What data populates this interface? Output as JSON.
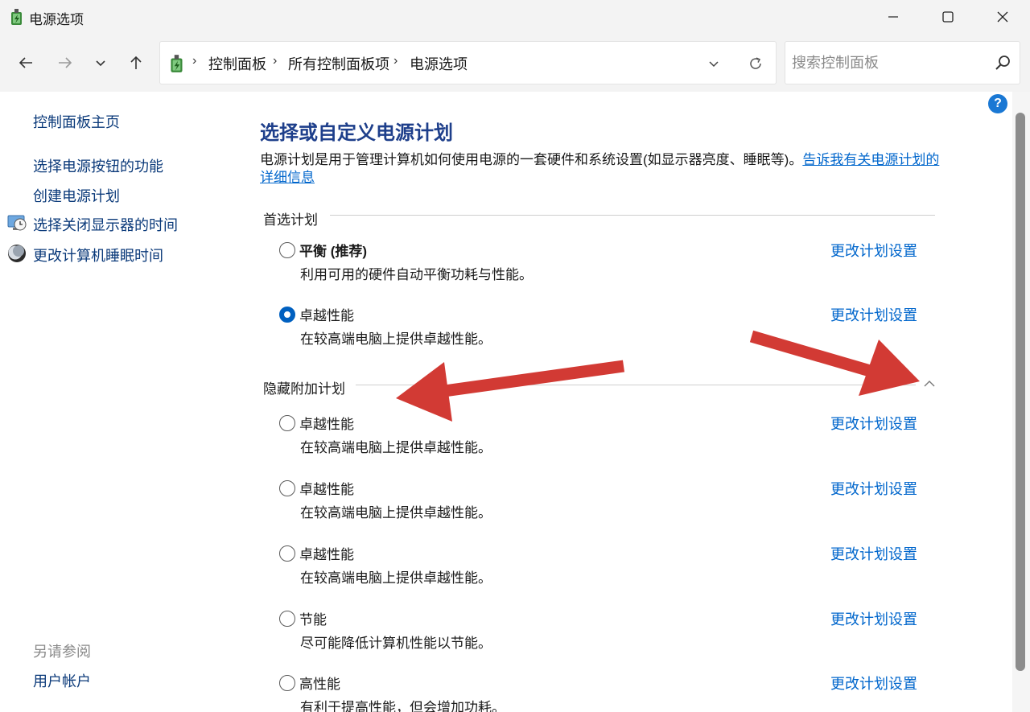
{
  "window": {
    "title": "电源选项"
  },
  "nav": {
    "breadcrumbs": [
      "控制面板",
      "所有控制面板项",
      "电源选项"
    ],
    "separator": "›",
    "search_placeholder": "搜索控制面板"
  },
  "sidebar": {
    "home": "控制面板主页",
    "links": [
      "选择电源按钮的功能",
      "创建电源计划",
      "选择关闭显示器的时间",
      "更改计算机睡眠时间"
    ],
    "see_also_title": "另请参阅",
    "see_also_links": [
      "用户帐户"
    ]
  },
  "main": {
    "title": "选择或自定义电源计划",
    "description": "电源计划是用于管理计算机如何使用电源的一套硬件和系统设置(如显示器亮度、睡眠等)。",
    "description_link": "告诉我有关电源计划的详细信息",
    "preferred_heading": "首选计划",
    "hidden_heading": "隐藏附加计划",
    "change_label": "更改计划设置",
    "help_label": "?",
    "preferred_plans": [
      {
        "name": "平衡 (推荐)",
        "desc": "利用可用的硬件自动平衡功耗与性能。",
        "selected": false
      },
      {
        "name": "卓越性能",
        "desc": "在较高端电脑上提供卓越性能。",
        "selected": true
      }
    ],
    "hidden_plans": [
      {
        "name": "卓越性能",
        "desc": "在较高端电脑上提供卓越性能。",
        "selected": false
      },
      {
        "name": "卓越性能",
        "desc": "在较高端电脑上提供卓越性能。",
        "selected": false
      },
      {
        "name": "卓越性能",
        "desc": "在较高端电脑上提供卓越性能。",
        "selected": false
      },
      {
        "name": "节能",
        "desc": "尽可能降低计算机性能以节能。",
        "selected": false
      },
      {
        "name": "高性能",
        "desc": "有利于提高性能，但会增加功耗。",
        "selected": false
      }
    ]
  },
  "colors": {
    "accent": "#0060c0",
    "link": "#0066cc",
    "title": "#1e3f8b",
    "annotation_arrow": "#d23a34"
  }
}
